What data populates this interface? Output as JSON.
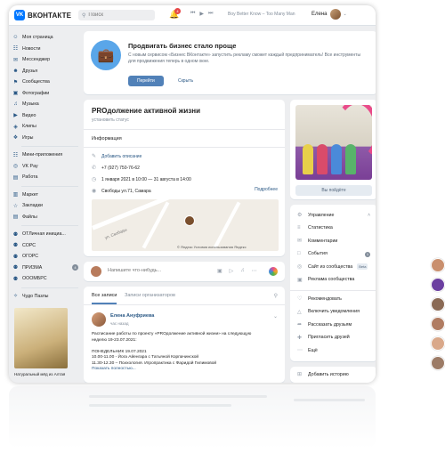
{
  "header": {
    "logo_text": "ВКОНТАКТЕ",
    "logo_badge": "VK",
    "search_placeholder": "Поиск",
    "notifications_count": "4",
    "track": "Boy Better Know – Too Many Man",
    "user_name": "Елена"
  },
  "sidebar": {
    "items": [
      {
        "label": "Моя страница",
        "icon": "user-icon"
      },
      {
        "label": "Новости",
        "icon": "news-icon"
      },
      {
        "label": "Мессенджер",
        "icon": "chat-icon"
      },
      {
        "label": "Друзья",
        "icon": "friends-icon"
      },
      {
        "label": "Сообщества",
        "icon": "groups-icon"
      },
      {
        "label": "Фотографии",
        "icon": "photo-icon"
      },
      {
        "label": "Музыка",
        "icon": "music-icon"
      },
      {
        "label": "Видео",
        "icon": "video-icon"
      },
      {
        "label": "Клипы",
        "icon": "clips-icon"
      },
      {
        "label": "Игры",
        "icon": "games-icon"
      }
    ],
    "items2": [
      {
        "label": "Мини-приложения",
        "icon": "apps-icon"
      },
      {
        "label": "VK Pay",
        "icon": "pay-icon"
      },
      {
        "label": "Работа",
        "icon": "work-icon"
      }
    ],
    "items3": [
      {
        "label": "Маркет",
        "icon": "market-icon"
      },
      {
        "label": "Закладки",
        "icon": "bookmark-icon"
      },
      {
        "label": "Файлы",
        "icon": "file-icon"
      }
    ],
    "items4": [
      {
        "label": "ОТЛичная инициа...",
        "icon": "group-icon"
      },
      {
        "label": "СОРС",
        "icon": "group-icon"
      },
      {
        "label": "ОГОРС",
        "icon": "group-icon"
      },
      {
        "label": "ПРИЗМА",
        "icon": "group-icon",
        "count": "4"
      },
      {
        "label": "ОООМБРС",
        "icon": "group-icon"
      }
    ],
    "items5": [
      {
        "label": "Чудо Пазлы",
        "icon": "puzzle-icon"
      }
    ],
    "promo_caption": "Натуральный мёд из Алтая"
  },
  "business": {
    "title": "Продвигать бизнес стало проще",
    "text": "С новым сервисом «Бизнес ВКонтакте» запустить рекламу сможет каждый предприниматель! Все инструменты для продвижения теперь в одном окне.",
    "primary_label": "Перейти",
    "secondary_label": "Скрыть"
  },
  "profile": {
    "name": "PROдолжение активной жизни",
    "status": "установить статус",
    "info_label": "Информация",
    "add_description": "Добавить описание",
    "phone": "+7 (927) 750-76-62",
    "dates": "1 января 2021 в 10:00 — 31 августа в 14:00",
    "address": "Свободы ул.71, Самара",
    "more": "Подробнее",
    "map_street": "ул. Свободы",
    "map_attr": "© Яндекс  Условия использования  Яндекс"
  },
  "composer": {
    "placeholder": "Напишите что-нибудь..."
  },
  "feed": {
    "tab_all": "Все записи",
    "tab_org": "Записи организаторов",
    "author": "Елена Ануфриева",
    "time": "час назад",
    "lines": [
      "Расписание работы по проекту «PROдолжение активной жизни» на следующую",
      "неделю 19-23.07.2021:",
      "",
      "ПОНЕДЕЛЬНИК 19.07.2021",
      "10.00-11.00 - Йога Айенгара с Татьяной Корпачинской",
      "11.30-12.30 – Психология. Игропрактика с Фаридой Гилимовой"
    ],
    "more": "Показать полностью..."
  },
  "right": {
    "follow_button": "Вы пойдёте",
    "menu": [
      {
        "label": "Управление",
        "icon": "gear-icon"
      },
      {
        "label": "Статистика",
        "icon": "stats-icon"
      },
      {
        "label": "Комментарии",
        "icon": "comment-icon"
      },
      {
        "label": "События",
        "icon": "event-icon",
        "count": "1"
      },
      {
        "label": "Сайт из сообщества",
        "icon": "globe-icon",
        "badge": "Beta"
      },
      {
        "label": "Реклама сообщества",
        "icon": "ad-icon"
      }
    ],
    "menu2": [
      {
        "label": "Рекомендовать",
        "icon": "like-icon"
      },
      {
        "label": "Включить уведомления",
        "icon": "bell-icon"
      },
      {
        "label": "Рассказать друзьям",
        "icon": "share-icon"
      },
      {
        "label": "Пригласить друзей",
        "icon": "invite-icon"
      },
      {
        "label": "Ещё",
        "icon": "more-icon"
      }
    ],
    "add_story": "Добавить историю"
  }
}
